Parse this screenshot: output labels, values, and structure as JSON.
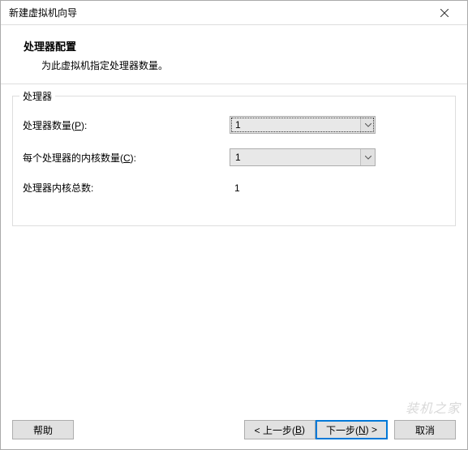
{
  "window": {
    "title": "新建虚拟机向导"
  },
  "header": {
    "title": "处理器配置",
    "subtitle": "为此虚拟机指定处理器数量。"
  },
  "groupbox": {
    "title": "处理器"
  },
  "fields": {
    "processor_count_label_prefix": "处理器数量(",
    "processor_count_hotkey": "P",
    "processor_count_label_suffix": "):",
    "processor_count_value": "1",
    "cores_label_prefix": "每个处理器的内核数量(",
    "cores_hotkey": "C",
    "cores_label_suffix": "):",
    "cores_value": "1",
    "total_label": "处理器内核总数:",
    "total_value": "1"
  },
  "buttons": {
    "help": "帮助",
    "back_prefix": "< 上一步(",
    "back_hotkey": "B",
    "back_suffix": ")",
    "next_prefix": "下一步(",
    "next_hotkey": "N",
    "next_suffix": ") >",
    "cancel": "取消"
  },
  "watermark": "装机之家"
}
